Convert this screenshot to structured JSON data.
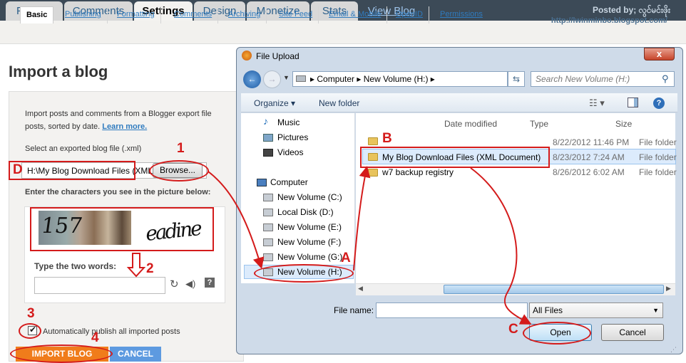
{
  "top_tabs": [
    "Posting",
    "Comments",
    "Settings",
    "Design",
    "Monetize",
    "Stats",
    "View Blog"
  ],
  "posted_by": "Posted by; လွင်မင်းဖိုး",
  "watermark": "http://lwinminbo.blogspot.com/",
  "sub_tabs": [
    "Basic",
    "Publishing",
    "Formatting",
    "Comments",
    "Archiving",
    "Site Feed",
    "Email & Mobile",
    "OpenID",
    "Permissions"
  ],
  "page_title": "Import a blog",
  "intro_line1": "Import posts and comments from a Blogger export file",
  "intro_line2": "posts, sorted by date.",
  "learn_more": "Learn more.",
  "select_label": "Select an exported blog file (.xml)",
  "file_value": "H:\\My Blog Download Files (XML",
  "browse_label": "Browse...",
  "captcha_label": "Enter the characters you see in the picture below:",
  "captcha_word1": "157",
  "captcha_word2": "eadine",
  "type_words_label": "Type the two words:",
  "autopublish_label": "Automatically publish all imported posts",
  "import_button": "IMPORT BLOG",
  "cancel_button": "CANCEL",
  "annotations": {
    "n1": "1",
    "n2": "2",
    "n3": "3",
    "n4": "4",
    "A": "A",
    "B": "B",
    "C": "C",
    "D": "D"
  },
  "dialog": {
    "title": "File Upload",
    "close": "x",
    "breadcrumb": [
      "Computer",
      "New Volume (H:)"
    ],
    "search_placeholder": "Search New Volume (H:)",
    "organize": "Organize ▾",
    "new_folder": "New folder",
    "nav_items": [
      "Music",
      "Pictures",
      "Videos",
      "Computer",
      "New Volume (C:)",
      "Local Disk (D:)",
      "New Volume (E:)",
      "New Volume (F:)",
      "New Volume (G:)",
      "New Volume (H:)"
    ],
    "columns": [
      "Date modified",
      "Type",
      "Size"
    ],
    "files": [
      {
        "name": "",
        "date": "8/22/2012 11:46 PM",
        "type": "File folder"
      },
      {
        "name": "My Blog Download Files (XML Document)",
        "date": "8/23/2012 7:24 AM",
        "type": "File folder"
      },
      {
        "name": "w7 backup registry",
        "date": "8/26/2012 6:02 AM",
        "type": "File folder"
      }
    ],
    "file_name_label": "File name:",
    "filter": "All Files",
    "open": "Open",
    "cancel": "Cancel"
  },
  "colors": {
    "annotation": "#d41b1b",
    "import": "#f07c1b",
    "cancel": "#5d9ae0",
    "accent": "#2f7bbf"
  }
}
